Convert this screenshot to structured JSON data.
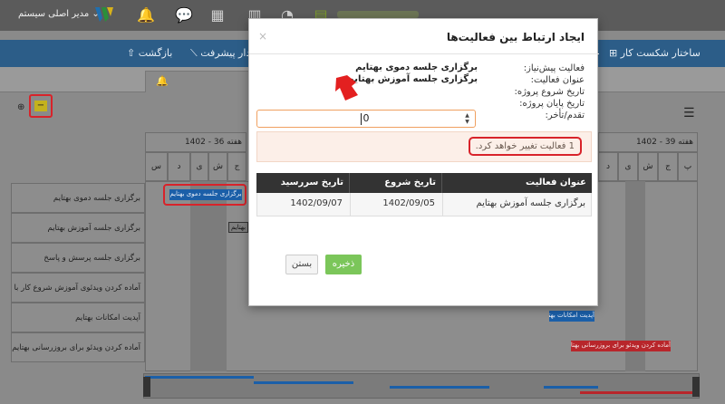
{
  "topbar": {
    "user_label": "مدیر اصلی سیستم",
    "user_caret": "⌄",
    "icons": [
      "logo-icon",
      "bell-icon",
      "chat-icon",
      "calendar-icon",
      "board-icon",
      "dashboard-icon",
      "clipboard-icon"
    ]
  },
  "nav": {
    "wbs": "ساختار شکست کار",
    "progress": "نمودار پیشرفت",
    "back": "بازگشت"
  },
  "gantt": {
    "week_left": "هفته 36 - 1402",
    "week_right": "هفته 39 - 1402",
    "days_left": [
      "س",
      "د",
      "ی",
      "ش",
      "ج",
      "پ",
      "چ",
      "س",
      "د"
    ],
    "days_right": [
      "ش",
      "ی",
      "د",
      "س",
      "چ",
      "پ",
      "ج",
      "ش",
      "ی",
      "د"
    ],
    "rows": [
      "برگزاری جلسه دموی بهتایم",
      "برگزاری جلسه آموزش بهتایم",
      "برگزاری جلسه پرسش و پاسخ",
      "آماده کردن ویدئوی آموزش شروع کار با بهتایم",
      "آپدیت امکانات بهتایم",
      "آماده کردن ویدئو برای بروزرسانی بهتایم"
    ],
    "bars": {
      "demo": "برگزاری جلسه دموی بهتایم",
      "training": "بهتایم",
      "update": "آپدیت امکانات بهتایم",
      "video": "آماده کردن ویدئو برای بروزرسانی بهتایم"
    }
  },
  "modal": {
    "title": "ایجاد ارتباط بین فعالیت‌ها",
    "close": "×",
    "labels": {
      "predecessor": "فعالیت پیش‌نیاز:",
      "activity": "عنوان فعالیت:",
      "start": "تاریخ شروع پروژه:",
      "end": "تاریخ پایان پروژه:",
      "lag": "تقدم/تأخر:"
    },
    "values": {
      "predecessor": "برگزاری جلسه دموی بهتایم",
      "activity": "برگزاری جلسه آموزش بهتایم"
    },
    "lag_value": "0",
    "spin_up": "▲",
    "spin_down": "▼",
    "alert": "1 فعالیت تغییر خواهد کرد.",
    "table": {
      "headers": [
        "عنوان فعالیت",
        "تاریخ شروع",
        "تاریخ سررسید"
      ],
      "rows": [
        [
          "برگزاری جلسه آموزش بهتایم",
          "1402/09/05",
          "1402/09/07"
        ]
      ]
    },
    "save": "ذخیره",
    "close_btn": "بستن"
  },
  "colors": {
    "nav": "#2c5d88",
    "bar_blue": "#1b5fa8",
    "bar_red": "#b8262b",
    "save": "#7bc65a",
    "highlight": "#d8232a",
    "arrow": "#e32020"
  }
}
